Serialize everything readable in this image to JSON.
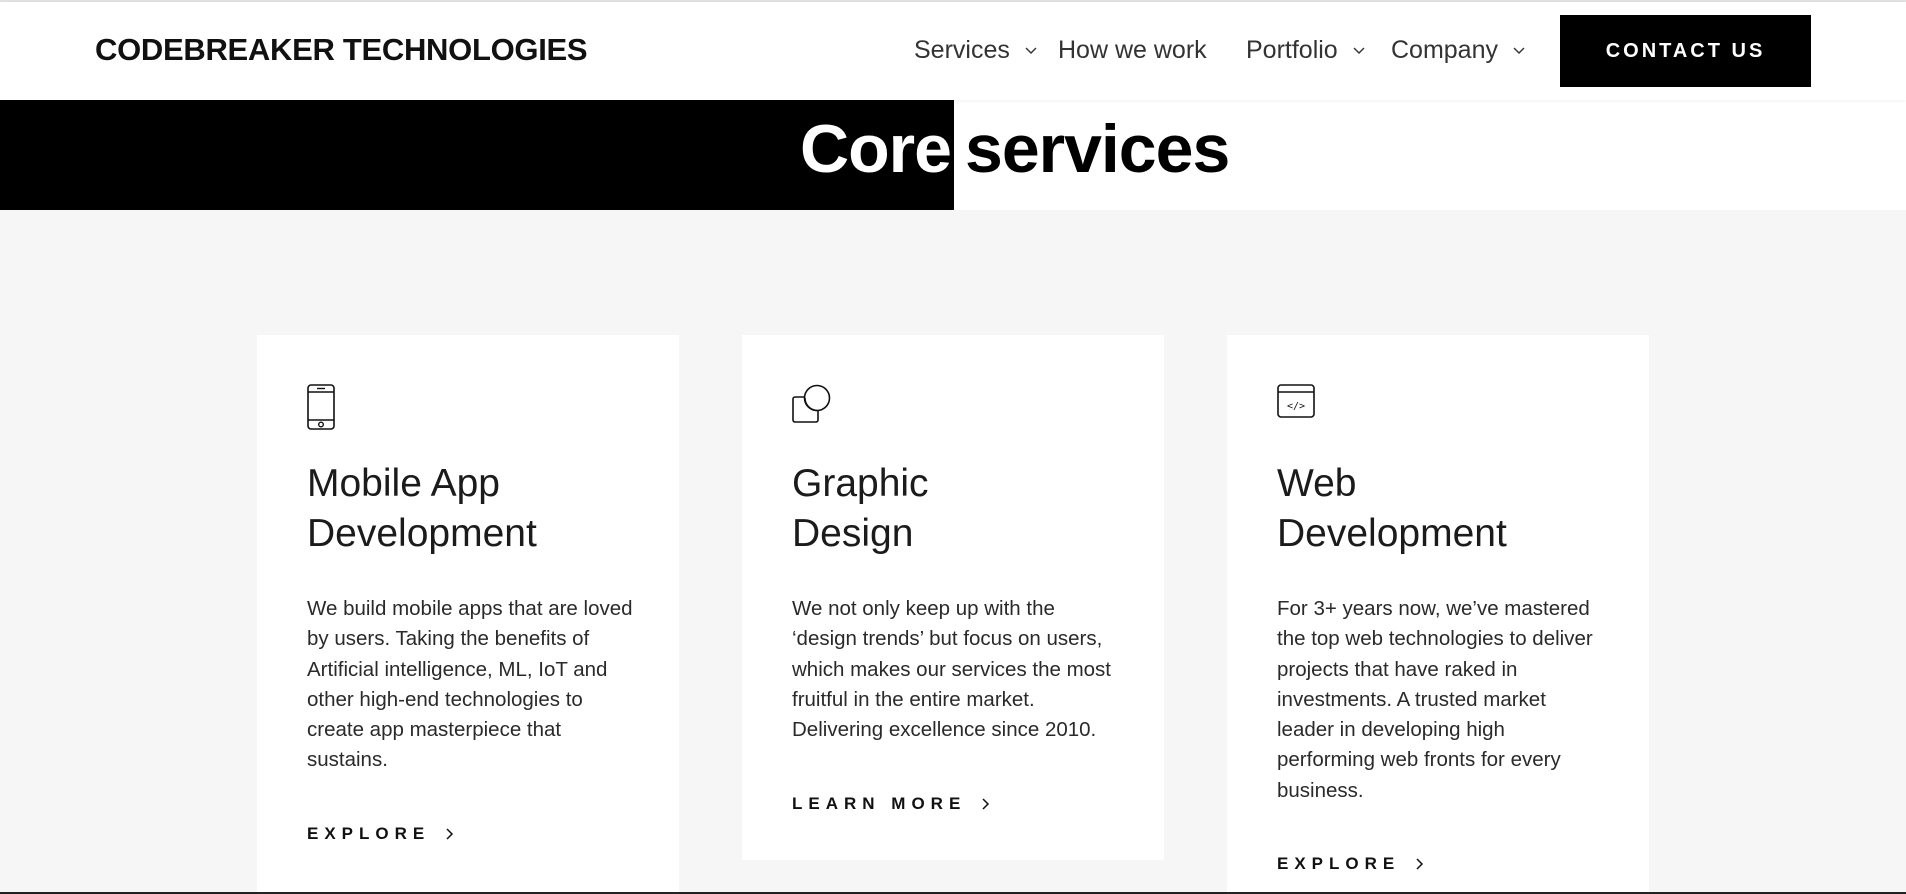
{
  "header": {
    "logo": "CODEBREAKER TECHNOLOGIES",
    "nav": [
      {
        "label": "Services",
        "has_dropdown": true
      },
      {
        "label": "How we work",
        "has_dropdown": false
      },
      {
        "label": "Portfolio",
        "has_dropdown": true
      },
      {
        "label": "Company",
        "has_dropdown": true
      }
    ],
    "contact_label": "CONTACT US"
  },
  "hero": {
    "word1": "Core",
    "word2": "services"
  },
  "cards": [
    {
      "icon": "mobile-phone-icon",
      "title_line1": "Mobile App",
      "title_line2": "Development",
      "description": "We build mobile apps that are loved by users. Taking the benefits of Artificial intelligence, ML, IoT and other high-end technologies to create app masterpiece that sustains.",
      "link_label": "EXPLORE"
    },
    {
      "icon": "design-shapes-icon",
      "title_line1": "Graphic",
      "title_line2": "Design",
      "description": "We not only keep up with the ‘design trends’ but focus on users, which makes our services the most fruitful in the entire market. Delivering excellence since 2010.",
      "link_label": "LEARN MORE"
    },
    {
      "icon": "code-window-icon",
      "title_line1": "Web",
      "title_line2": "Development",
      "description": "For 3+ years now, we’ve mastered the top web technologies to deliver projects that have raked in investments. A trusted market leader in developing high performing web fronts for every business.",
      "link_label": "EXPLORE"
    }
  ],
  "colors": {
    "accent": "#000000",
    "background": "#f6f6f6",
    "card": "#ffffff"
  }
}
